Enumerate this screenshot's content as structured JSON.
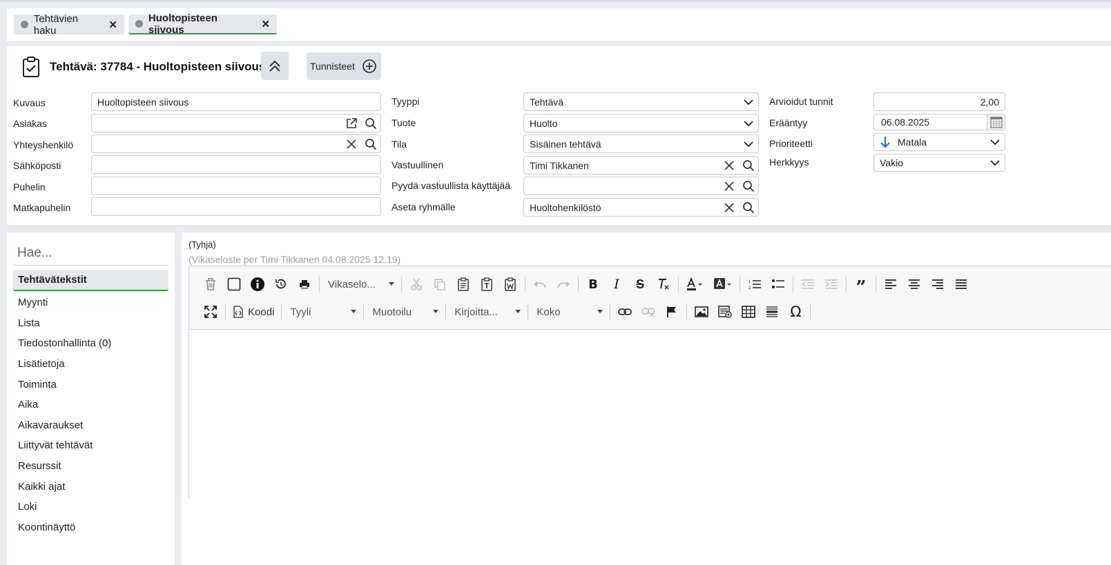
{
  "tabs": [
    {
      "label": "Tehtävien haku",
      "active": false
    },
    {
      "label": "Huoltopisteen siivous",
      "active": true
    }
  ],
  "header": {
    "title": "Tehtävä: 37784 - Huoltopisteen siivous",
    "tags_label": "Tunnisteet"
  },
  "form": {
    "col1": {
      "kuvaus": {
        "label": "Kuvaus",
        "value": "Huoltopisteen siivous"
      },
      "asiakas": {
        "label": "Asiakas",
        "value": ""
      },
      "yhteyshenkilo": {
        "label": "Yhteyshenkilö",
        "value": ""
      },
      "sahkoposti": {
        "label": "Sähköposti",
        "value": ""
      },
      "puhelin": {
        "label": "Puhelin",
        "value": ""
      },
      "matkapuhelin": {
        "label": "Matkapuhelin",
        "value": ""
      }
    },
    "col2": {
      "tyyppi": {
        "label": "Tyyppi",
        "value": "Tehtävä"
      },
      "tuote": {
        "label": "Tuote",
        "value": "Huolto"
      },
      "tila": {
        "label": "Tila",
        "value": "Sisäinen tehtävä"
      },
      "vastuullinen": {
        "label": "Vastuullinen",
        "value": "Timi Tikkanen"
      },
      "pyyda": {
        "label": "Pyydä vastuullista käyttäjää",
        "value": ""
      },
      "ryhma": {
        "label": "Aseta ryhmälle",
        "value": "Huoltohenkilöstö"
      }
    },
    "col3": {
      "tunnit": {
        "label": "Arvioidut tunnit",
        "value": "2,00"
      },
      "eraantyy": {
        "label": "Erääntyy",
        "value": "06.08.2025"
      },
      "prioriteetti": {
        "label": "Prioriteetti",
        "value": "Matala"
      },
      "herkkyys": {
        "label": "Herkkyys",
        "value": "Vakio"
      }
    }
  },
  "sidebar": {
    "search_placeholder": "Hae...",
    "items": [
      {
        "label": "Tehtävätekstit",
        "active": true
      },
      {
        "label": "Myynti"
      },
      {
        "label": "Lista"
      },
      {
        "label": "Tiedostonhallinta (0)"
      },
      {
        "label": "Lisätietoja"
      },
      {
        "label": "Toiminta"
      },
      {
        "label": "Aika"
      },
      {
        "label": "Aikavaraukset"
      },
      {
        "label": "Liittyvät tehtävät"
      },
      {
        "label": "Resurssit"
      },
      {
        "label": "Kaikki ajat"
      },
      {
        "label": "Loki"
      },
      {
        "label": "Koontinäyttö"
      }
    ]
  },
  "editor": {
    "empty_label": "(Tyhjä)",
    "sub_label": "(Vikaseloste per Timi Tikkanen 04.08.2025 12.19)",
    "template_combo": "Vikaselo...",
    "code_label": "Koodi",
    "style_combo": "Tyyli",
    "format_combo": "Muotoilu",
    "font_combo": "Kirjoitta...",
    "size_combo": "Koko"
  },
  "colors": {
    "accent_green": "#2f9e44",
    "priority_arrow": "#1f6fd1"
  }
}
